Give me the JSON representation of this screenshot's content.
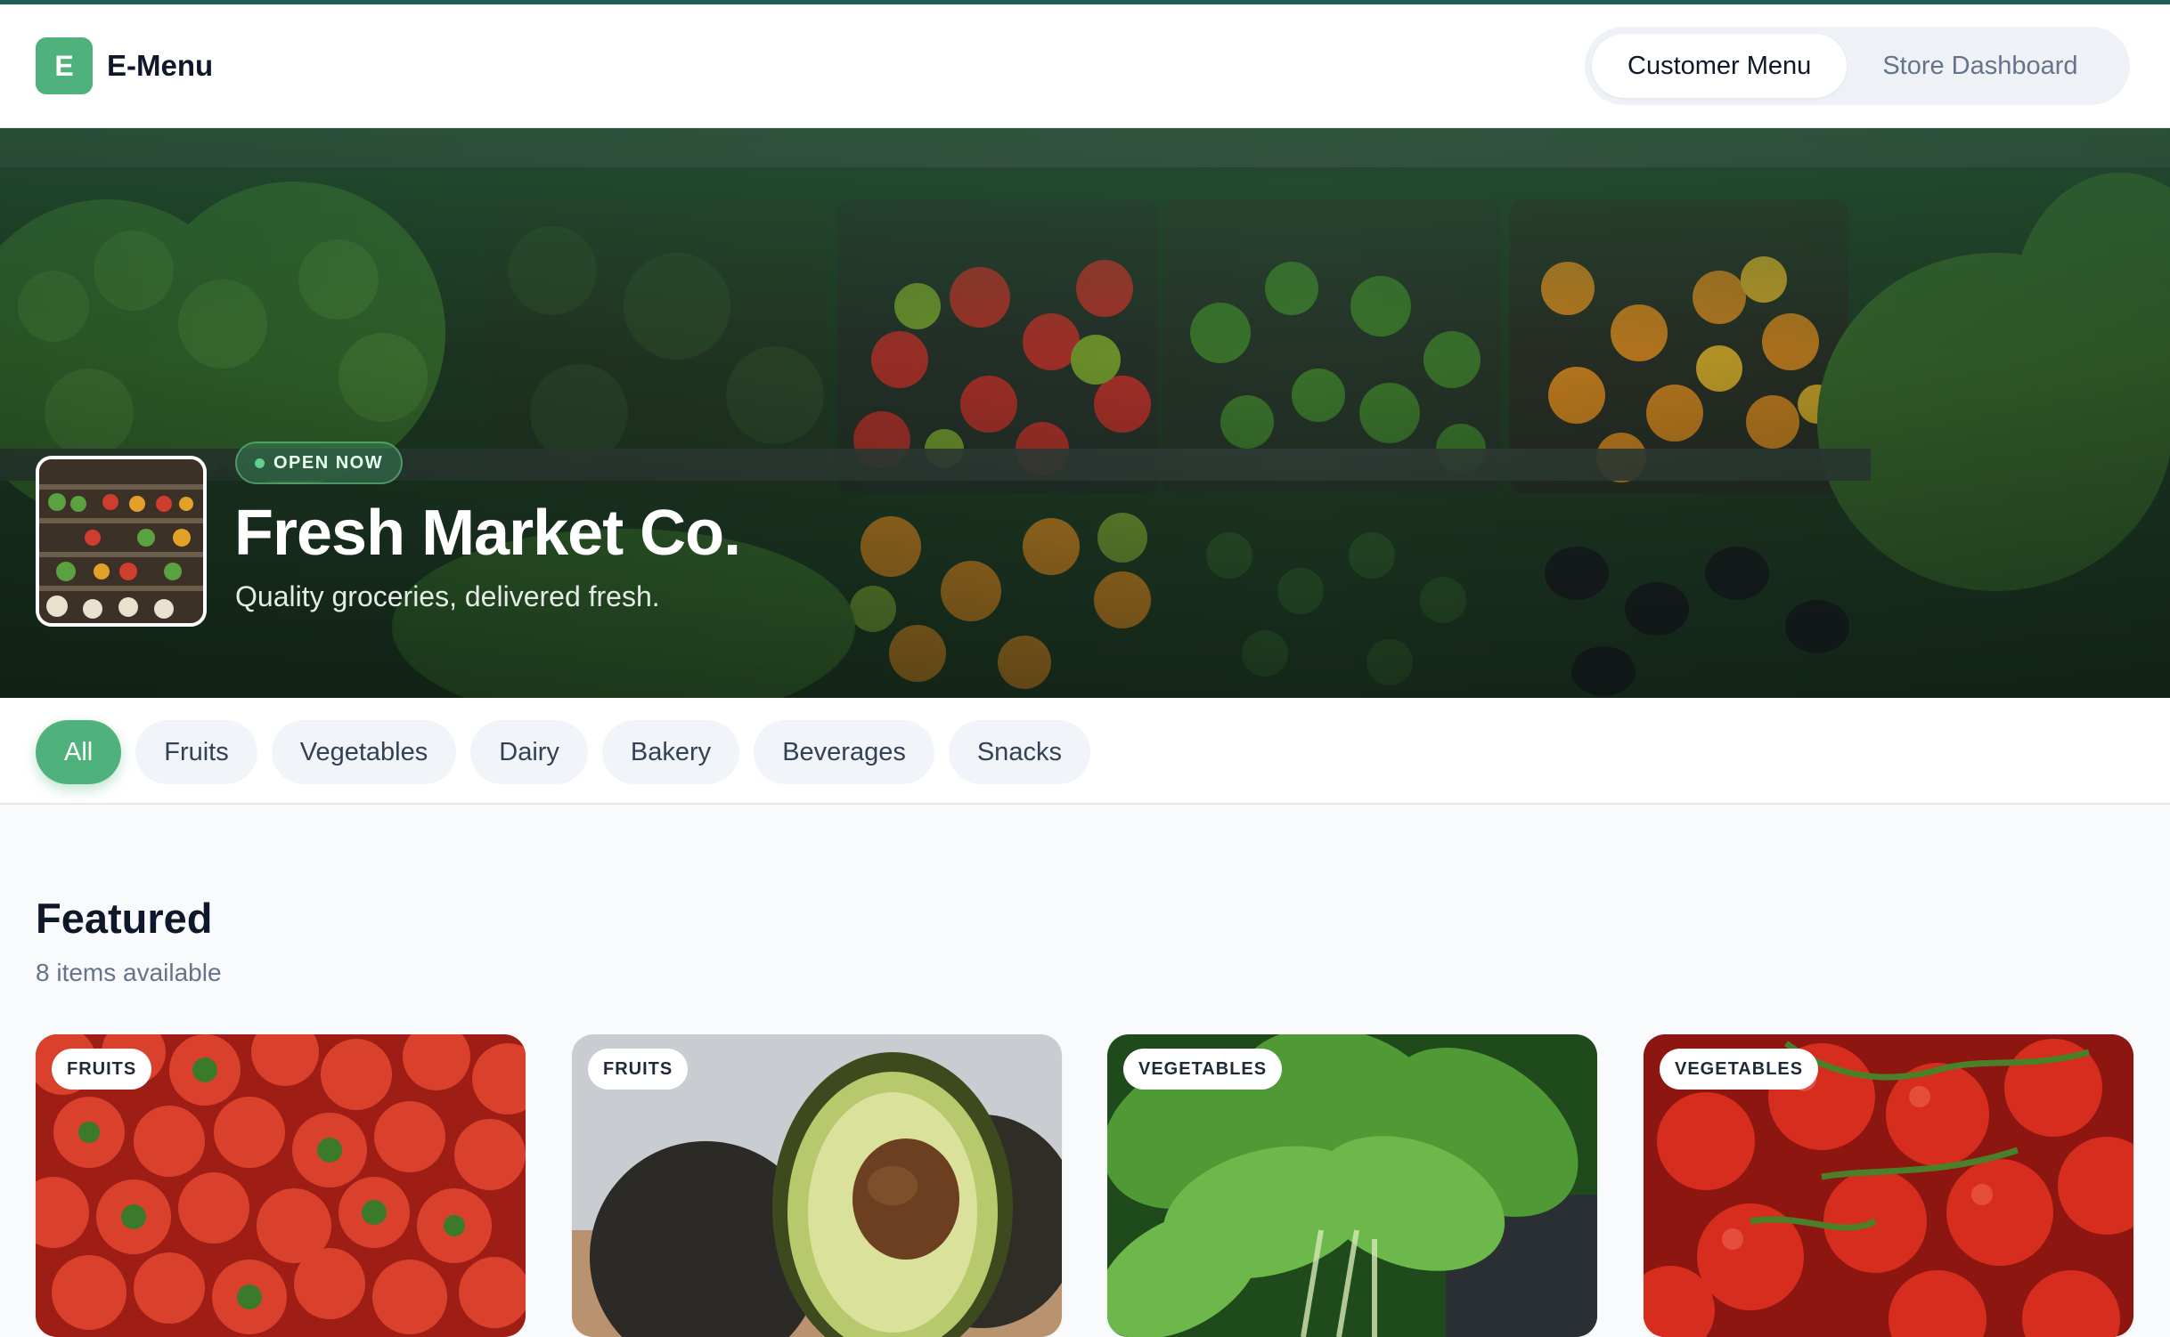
{
  "brand": {
    "initial": "E",
    "name": "E-Menu",
    "color": "#4fb27c"
  },
  "view_switcher": {
    "options": [
      "Customer Menu",
      "Store Dashboard"
    ],
    "selected": "Customer Menu"
  },
  "store": {
    "status": "OPEN NOW",
    "name": "Fresh Market Co.",
    "tagline": "Quality groceries, delivered fresh."
  },
  "categories": {
    "items": [
      "All",
      "Fruits",
      "Vegetables",
      "Dairy",
      "Bakery",
      "Beverages",
      "Snacks"
    ],
    "selected": "All"
  },
  "section": {
    "title": "Featured",
    "count_text": "8 items available"
  },
  "products": [
    {
      "category_tag": "FRUITS",
      "image": "strawberries"
    },
    {
      "category_tag": "FRUITS",
      "image": "avocado"
    },
    {
      "category_tag": "VEGETABLES",
      "image": "spinach"
    },
    {
      "category_tag": "VEGETABLES",
      "image": "tomatoes"
    }
  ]
}
